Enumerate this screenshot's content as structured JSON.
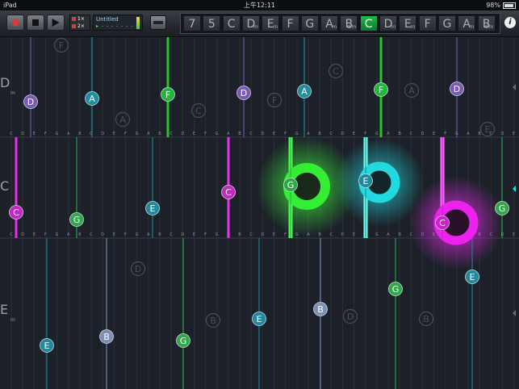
{
  "status_bar": {
    "device": "iPad",
    "time": "上午12:11",
    "battery": "98%"
  },
  "toolbar": {
    "loop_counts": [
      "1",
      "2"
    ],
    "song_name": "Untitled",
    "song_time": "▸ - - - -  - - - -"
  },
  "chord_keys": [
    {
      "root": "7",
      "quality": ""
    },
    {
      "root": "5",
      "quality": ""
    },
    {
      "root": "C",
      "quality": ""
    },
    {
      "root": "D",
      "quality": "m"
    },
    {
      "root": "E",
      "quality": "m"
    },
    {
      "root": "F",
      "quality": ""
    },
    {
      "root": "G",
      "quality": ""
    },
    {
      "root": "A",
      "quality": "m"
    },
    {
      "root": "B",
      "quality": "dim"
    },
    {
      "root": "C",
      "quality": "",
      "active": true
    },
    {
      "root": "D",
      "quality": "m"
    },
    {
      "root": "E",
      "quality": "m"
    },
    {
      "root": "F",
      "quality": ""
    },
    {
      "root": "G",
      "quality": ""
    },
    {
      "root": "A",
      "quality": "m"
    },
    {
      "root": "B",
      "quality": "dim"
    }
  ],
  "info_label": "i",
  "colors": {
    "C": "#c427c4",
    "D": "#7a5ab5",
    "E": "#1f8a9e",
    "F": "#1fb83a",
    "G": "#2fa84a",
    "A": "#1f8fa0",
    "B": "#7d8fb5",
    "ghost": "#4a4f57",
    "bg": "#1c2129",
    "staff_line": "#2a2f37"
  },
  "rows": [
    {
      "chord_root": "D",
      "chord_quality": "m",
      "scale_labels": [
        "C",
        "D",
        "E",
        "F",
        "G",
        "A",
        "B",
        "C",
        "D",
        "E",
        "F",
        "G",
        "A",
        "B",
        "C",
        "D",
        "E",
        "F",
        "G",
        "A",
        "B",
        "C",
        "D",
        "E",
        "F",
        "G",
        "A",
        "B",
        "C",
        "D",
        "E",
        "F",
        "G",
        "A",
        "B",
        "C",
        "D",
        "E",
        "F",
        "G",
        "A",
        "B",
        "C",
        "D",
        "E"
      ],
      "notes": [
        "D",
        "A",
        "F",
        "D",
        "A",
        "F",
        "D"
      ],
      "ghosts": [
        "F",
        "C",
        "A",
        "F",
        "C",
        "A",
        "E"
      ]
    },
    {
      "chord_root": "C",
      "chord_quality": "",
      "scale_labels": [
        "C",
        "D",
        "E",
        "F",
        "G",
        "A",
        "B",
        "C",
        "D",
        "E",
        "F",
        "G",
        "A",
        "B",
        "C",
        "D",
        "E",
        "F",
        "G",
        "A",
        "B",
        "C",
        "D",
        "E",
        "F",
        "G",
        "A",
        "B",
        "C",
        "D",
        "E",
        "F",
        "G",
        "A",
        "B",
        "C",
        "D",
        "E",
        "F",
        "G",
        "A",
        "B",
        "C",
        "D",
        "E"
      ],
      "notes": [
        "C",
        "G",
        "E",
        "C",
        "G",
        "E",
        "C",
        "G"
      ],
      "ghosts": []
    },
    {
      "chord_root": "E",
      "chord_quality": "m",
      "scale_labels": [],
      "notes": [
        "E",
        "B",
        "G",
        "E",
        "B",
        "G",
        "E"
      ],
      "ghosts": [
        "D",
        "B",
        "D",
        "B"
      ]
    }
  ]
}
